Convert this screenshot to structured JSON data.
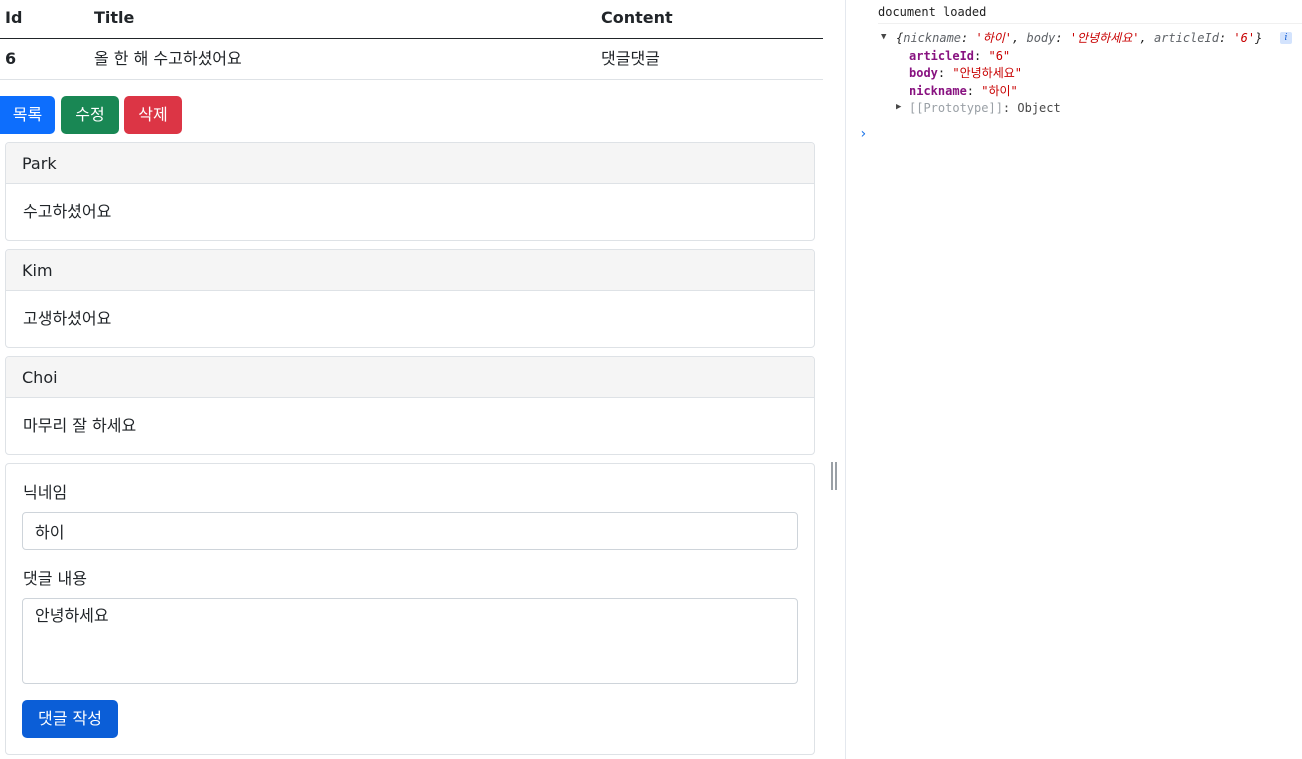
{
  "table": {
    "headers": {
      "id": "Id",
      "title": "Title",
      "content": "Content"
    },
    "row": {
      "id": "6",
      "title": "올 한 해 수고하셨어요",
      "content": "댓글댓글"
    }
  },
  "buttons": {
    "list": "목록",
    "edit": "수정",
    "delete": "삭제"
  },
  "comments": [
    {
      "nickname": "Park",
      "body": "수고하셨어요"
    },
    {
      "nickname": "Kim",
      "body": "고생하셨어요"
    },
    {
      "nickname": "Choi",
      "body": "마무리 잘 하세요"
    }
  ],
  "form": {
    "nickname_label": "닉네임",
    "nickname_value": "하이",
    "body_label": "댓글 내용",
    "body_value": "안녕하세요",
    "submit_label": "댓글 작성"
  },
  "console": {
    "log_message": "document loaded",
    "object_preview": {
      "open": "{",
      "k1": "nickname",
      "v1": "'하이'",
      "k2": "body",
      "v2": "'안녕하세요'",
      "k3": "articleId",
      "v3": "'6'",
      "close": "}"
    },
    "info_badge": "i",
    "properties": [
      {
        "key": "articleId",
        "value": "\"6\""
      },
      {
        "key": "body",
        "value": "\"안녕하세요\""
      },
      {
        "key": "nickname",
        "value": "\"하이\""
      }
    ],
    "prototype_key": "[[Prototype]]",
    "prototype_value": "Object",
    "prompt_symbol": "›"
  },
  "icons": {
    "expanded": "triangle-down-icon",
    "collapsed": "triangle-right-icon",
    "prompt": "chevron-right-icon",
    "resize": "resize-grip-icon"
  },
  "colors": {
    "primary": "#0d6efd",
    "success": "#198754",
    "danger": "#dc3545",
    "submit": "#0b5ed7"
  }
}
